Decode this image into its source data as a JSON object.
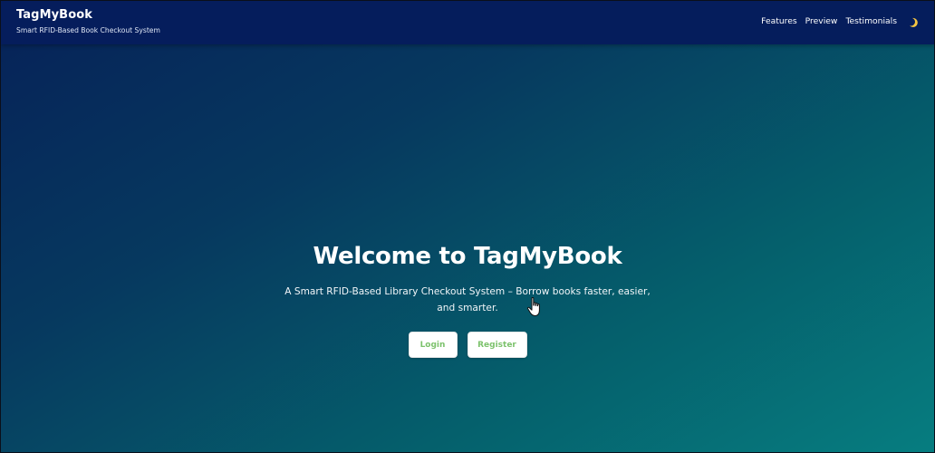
{
  "navbar": {
    "brand_title": "TagMyBook",
    "brand_tagline": "Smart RFID-Based Book Checkout System",
    "links": [
      {
        "label": "Features"
      },
      {
        "label": "Preview"
      },
      {
        "label": "Testimonials"
      }
    ],
    "theme_toggle_icon": "moon-icon"
  },
  "hero": {
    "title": "Welcome to TagMyBook",
    "subtitle": "A Smart RFID-Based Library Checkout System – Borrow books faster, easier, and smarter.",
    "login_label": "Login",
    "register_label": "Register"
  },
  "colors": {
    "navbar_bg": "#051d5c",
    "gradient_start": "#062158",
    "gradient_end": "#067d80",
    "button_text": "#7cc26c",
    "moon": "#f5c542"
  }
}
